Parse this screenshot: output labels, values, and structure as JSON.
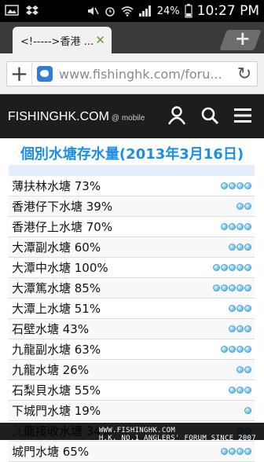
{
  "statusbar": {
    "battery": "24%",
    "time": "10:27 PM"
  },
  "tab": {
    "title": "<!----->香港 ...",
    "close": "✕"
  },
  "newtab": "+",
  "url": {
    "plus": "+",
    "text": "www.fishinghk.com/foru...",
    "reload": "↻"
  },
  "site": {
    "logo": "FISHINGHK.COM",
    "logo_sub": "@ mobile"
  },
  "page_title": "個別水塘存水量(2013年3月16日)",
  "reservoirs": [
    {
      "name": "薄扶林水塘 73%",
      "level": 4
    },
    {
      "name": "香港仔下水塘 39%",
      "level": 2
    },
    {
      "name": "香港仔上水塘 70%",
      "level": 4
    },
    {
      "name": "大潭副水塘 60%",
      "level": 3
    },
    {
      "name": "大潭中水塘 100%",
      "level": 5
    },
    {
      "name": "大潭篤水塘 85%",
      "level": 5
    },
    {
      "name": "大潭上水塘 51%",
      "level": 3
    },
    {
      "name": "石壁水塘 43%",
      "level": 3
    },
    {
      "name": "九龍副水塘 63%",
      "level": 4
    },
    {
      "name": "九龍水塘 26%",
      "level": 2
    },
    {
      "name": "石梨貝水塘 55%",
      "level": 3
    },
    {
      "name": "下城門水塘 19%",
      "level": 1
    },
    {
      "name": "九龍接收水塘 34%",
      "level": 2
    },
    {
      "name": "城門水塘 65%",
      "level": 4
    }
  ],
  "footer": "H.K. NO.1 ANGLERS' FORUM SINCE 2007",
  "footer_site": "WWW.FISHINGHK.COM"
}
